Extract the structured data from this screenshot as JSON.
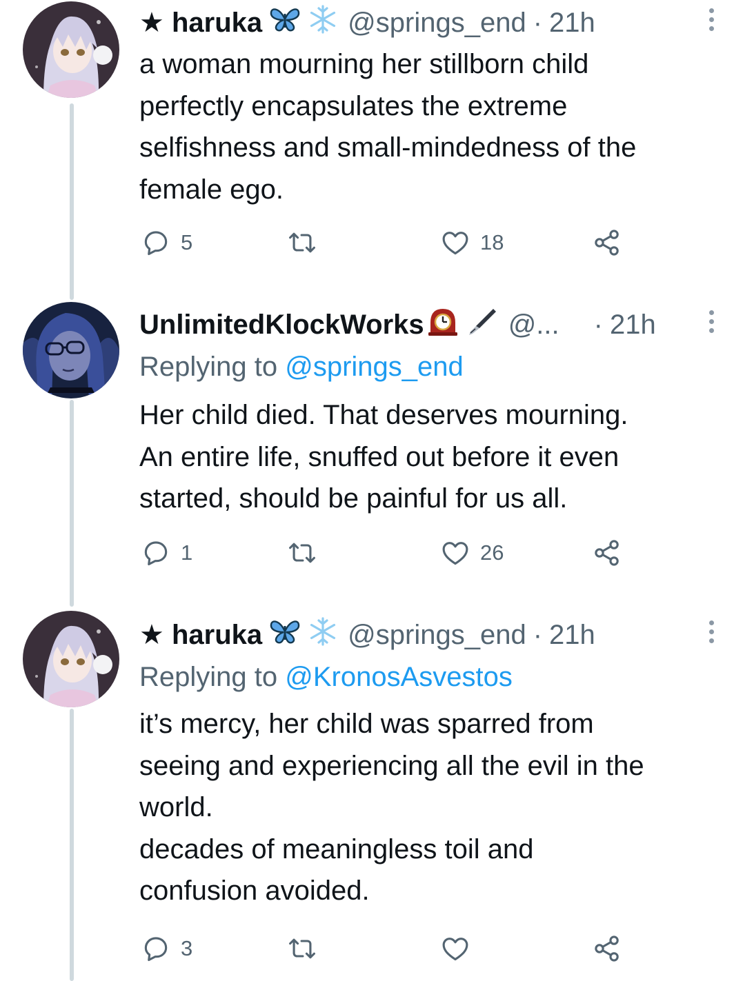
{
  "tweets": [
    {
      "display_name": "★ haruka",
      "name_emoji": [
        "butterfly-icon",
        "snowflake-icon"
      ],
      "handle": "@springs_end",
      "separator": "·",
      "time": "21h",
      "replying_prefix": "",
      "replying_to": "",
      "text": "a woman mourning her stillborn child\nperfectly encapsulates the extreme\nselfishness and small-mindedness of the\nfemale ego.",
      "reply_count": "5",
      "retweet_count": "",
      "like_count": "18"
    },
    {
      "display_name": "UnlimitedKlockWorks",
      "name_emoji": [
        "mantel-clock-icon",
        "fountain-pen-icon"
      ],
      "handle": "@...",
      "separator": "·",
      "time": "21h",
      "replying_prefix": "Replying to",
      "replying_to": "@springs_end",
      "text": "Her child died. That deserves mourning.\nAn entire life, snuffed out before it even\nstarted, should be painful for us all.",
      "reply_count": "1",
      "retweet_count": "",
      "like_count": "26"
    },
    {
      "display_name": "★ haruka",
      "name_emoji": [
        "butterfly-icon",
        "snowflake-icon"
      ],
      "handle": "@springs_end",
      "separator": "·",
      "time": "21h",
      "replying_prefix": "Replying to",
      "replying_to": "@KronosAsvestos",
      "text": "it’s mercy, her child was sparred from\nseeing and experiencing all the evil in the\nworld.\ndecades of meaningless toil and\nconfusion avoided.",
      "reply_count": "3",
      "retweet_count": "",
      "like_count": ""
    }
  ],
  "colors": {
    "text": "#0f1419",
    "secondary": "#536471",
    "link": "#1d9bf0",
    "thread_line": "#cfd9de"
  }
}
